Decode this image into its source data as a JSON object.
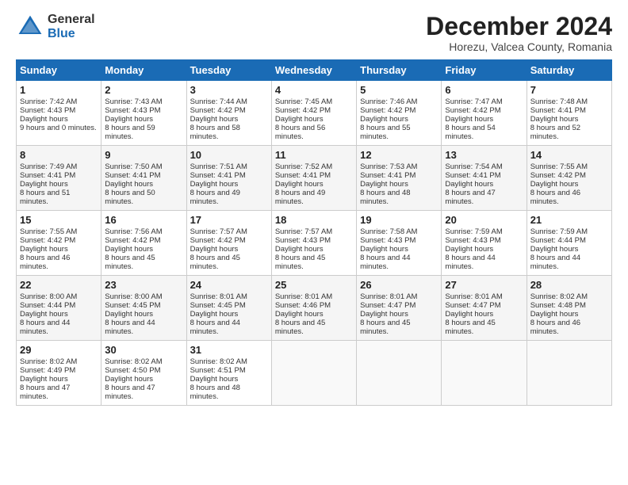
{
  "logo": {
    "general": "General",
    "blue": "Blue"
  },
  "title": "December 2024",
  "subtitle": "Horezu, Valcea County, Romania",
  "days_of_week": [
    "Sunday",
    "Monday",
    "Tuesday",
    "Wednesday",
    "Thursday",
    "Friday",
    "Saturday"
  ],
  "weeks": [
    [
      {
        "day": 1,
        "sunrise": "7:42 AM",
        "sunset": "4:43 PM",
        "daylight": "9 hours and 0 minutes."
      },
      {
        "day": 2,
        "sunrise": "7:43 AM",
        "sunset": "4:43 PM",
        "daylight": "8 hours and 59 minutes."
      },
      {
        "day": 3,
        "sunrise": "7:44 AM",
        "sunset": "4:42 PM",
        "daylight": "8 hours and 58 minutes."
      },
      {
        "day": 4,
        "sunrise": "7:45 AM",
        "sunset": "4:42 PM",
        "daylight": "8 hours and 56 minutes."
      },
      {
        "day": 5,
        "sunrise": "7:46 AM",
        "sunset": "4:42 PM",
        "daylight": "8 hours and 55 minutes."
      },
      {
        "day": 6,
        "sunrise": "7:47 AM",
        "sunset": "4:42 PM",
        "daylight": "8 hours and 54 minutes."
      },
      {
        "day": 7,
        "sunrise": "7:48 AM",
        "sunset": "4:41 PM",
        "daylight": "8 hours and 52 minutes."
      }
    ],
    [
      {
        "day": 8,
        "sunrise": "7:49 AM",
        "sunset": "4:41 PM",
        "daylight": "8 hours and 51 minutes."
      },
      {
        "day": 9,
        "sunrise": "7:50 AM",
        "sunset": "4:41 PM",
        "daylight": "8 hours and 50 minutes."
      },
      {
        "day": 10,
        "sunrise": "7:51 AM",
        "sunset": "4:41 PM",
        "daylight": "8 hours and 49 minutes."
      },
      {
        "day": 11,
        "sunrise": "7:52 AM",
        "sunset": "4:41 PM",
        "daylight": "8 hours and 49 minutes."
      },
      {
        "day": 12,
        "sunrise": "7:53 AM",
        "sunset": "4:41 PM",
        "daylight": "8 hours and 48 minutes."
      },
      {
        "day": 13,
        "sunrise": "7:54 AM",
        "sunset": "4:41 PM",
        "daylight": "8 hours and 47 minutes."
      },
      {
        "day": 14,
        "sunrise": "7:55 AM",
        "sunset": "4:42 PM",
        "daylight": "8 hours and 46 minutes."
      }
    ],
    [
      {
        "day": 15,
        "sunrise": "7:55 AM",
        "sunset": "4:42 PM",
        "daylight": "8 hours and 46 minutes."
      },
      {
        "day": 16,
        "sunrise": "7:56 AM",
        "sunset": "4:42 PM",
        "daylight": "8 hours and 45 minutes."
      },
      {
        "day": 17,
        "sunrise": "7:57 AM",
        "sunset": "4:42 PM",
        "daylight": "8 hours and 45 minutes."
      },
      {
        "day": 18,
        "sunrise": "7:57 AM",
        "sunset": "4:43 PM",
        "daylight": "8 hours and 45 minutes."
      },
      {
        "day": 19,
        "sunrise": "7:58 AM",
        "sunset": "4:43 PM",
        "daylight": "8 hours and 44 minutes."
      },
      {
        "day": 20,
        "sunrise": "7:59 AM",
        "sunset": "4:43 PM",
        "daylight": "8 hours and 44 minutes."
      },
      {
        "day": 21,
        "sunrise": "7:59 AM",
        "sunset": "4:44 PM",
        "daylight": "8 hours and 44 minutes."
      }
    ],
    [
      {
        "day": 22,
        "sunrise": "8:00 AM",
        "sunset": "4:44 PM",
        "daylight": "8 hours and 44 minutes."
      },
      {
        "day": 23,
        "sunrise": "8:00 AM",
        "sunset": "4:45 PM",
        "daylight": "8 hours and 44 minutes."
      },
      {
        "day": 24,
        "sunrise": "8:01 AM",
        "sunset": "4:45 PM",
        "daylight": "8 hours and 44 minutes."
      },
      {
        "day": 25,
        "sunrise": "8:01 AM",
        "sunset": "4:46 PM",
        "daylight": "8 hours and 45 minutes."
      },
      {
        "day": 26,
        "sunrise": "8:01 AM",
        "sunset": "4:47 PM",
        "daylight": "8 hours and 45 minutes."
      },
      {
        "day": 27,
        "sunrise": "8:01 AM",
        "sunset": "4:47 PM",
        "daylight": "8 hours and 45 minutes."
      },
      {
        "day": 28,
        "sunrise": "8:02 AM",
        "sunset": "4:48 PM",
        "daylight": "8 hours and 46 minutes."
      }
    ],
    [
      {
        "day": 29,
        "sunrise": "8:02 AM",
        "sunset": "4:49 PM",
        "daylight": "8 hours and 47 minutes."
      },
      {
        "day": 30,
        "sunrise": "8:02 AM",
        "sunset": "4:50 PM",
        "daylight": "8 hours and 47 minutes."
      },
      {
        "day": 31,
        "sunrise": "8:02 AM",
        "sunset": "4:51 PM",
        "daylight": "8 hours and 48 minutes."
      },
      null,
      null,
      null,
      null
    ]
  ]
}
